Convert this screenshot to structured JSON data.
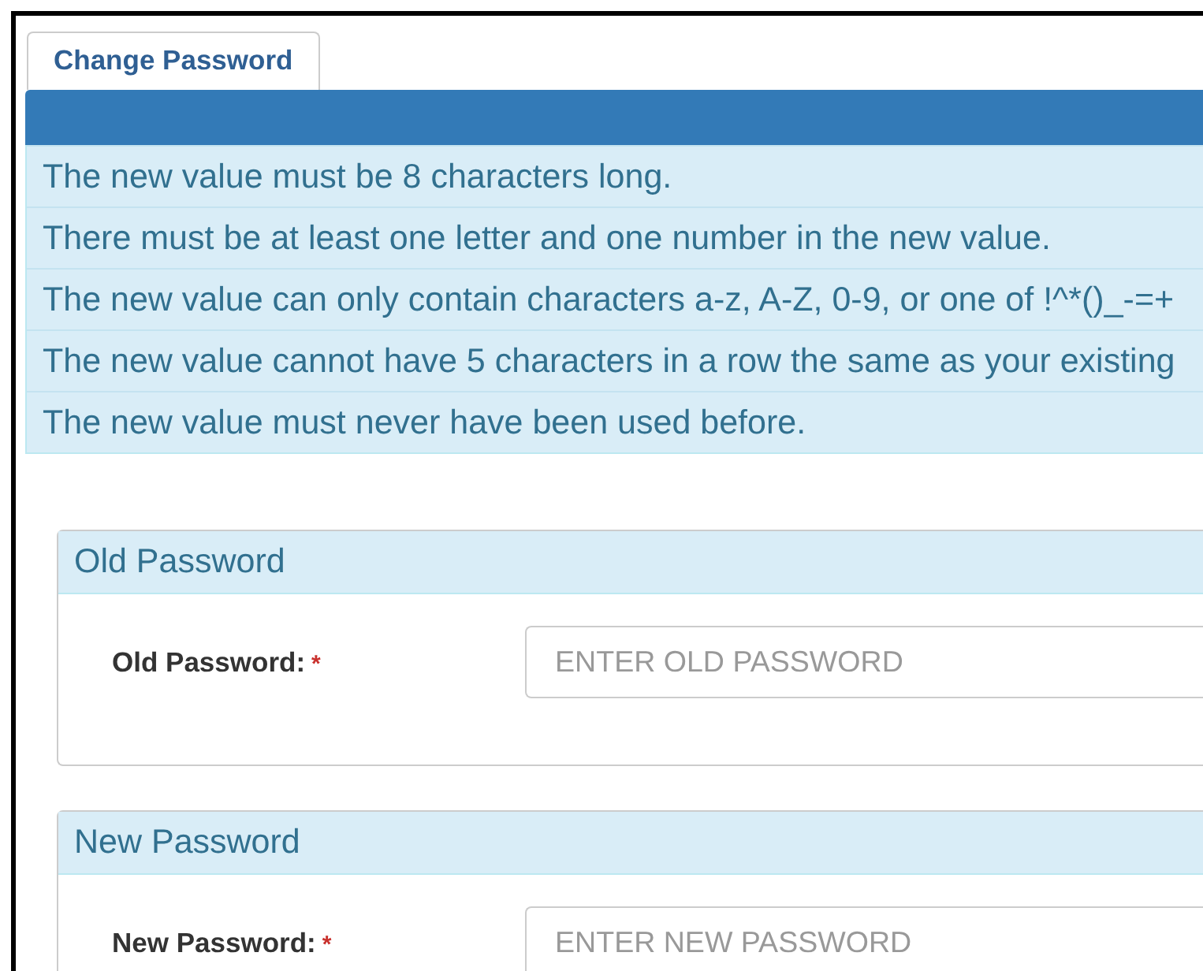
{
  "tabs": [
    {
      "label": "Change Password",
      "selected": true
    }
  ],
  "rules": [
    "The new value must be 8 characters long.",
    "There must be at least one letter and one number in the new value.",
    "The new value can only contain characters a-z, A-Z, 0-9, or one of !^*()_-=+",
    "The new value cannot have 5 characters in a row the same as your existing",
    "The new value must never have been used before."
  ],
  "sections": [
    {
      "title": "Old Password",
      "label": "Old Password:",
      "required_mark": "*",
      "placeholder": "ENTER OLD PASSWORD"
    },
    {
      "title": "New Password",
      "label": "New Password:",
      "required_mark": "*",
      "placeholder": "ENTER NEW PASSWORD"
    }
  ]
}
